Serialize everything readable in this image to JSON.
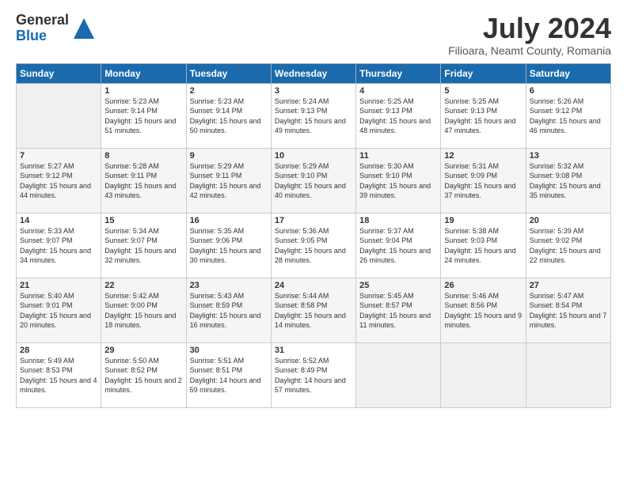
{
  "logo": {
    "general": "General",
    "blue": "Blue"
  },
  "title": "July 2024",
  "subtitle": "Filioara, Neamt County, Romania",
  "headers": [
    "Sunday",
    "Monday",
    "Tuesday",
    "Wednesday",
    "Thursday",
    "Friday",
    "Saturday"
  ],
  "weeks": [
    [
      {
        "day": "",
        "empty": true
      },
      {
        "day": "1",
        "sunrise": "Sunrise: 5:23 AM",
        "sunset": "Sunset: 9:14 PM",
        "daylight": "Daylight: 15 hours and 51 minutes."
      },
      {
        "day": "2",
        "sunrise": "Sunrise: 5:23 AM",
        "sunset": "Sunset: 9:14 PM",
        "daylight": "Daylight: 15 hours and 50 minutes."
      },
      {
        "day": "3",
        "sunrise": "Sunrise: 5:24 AM",
        "sunset": "Sunset: 9:13 PM",
        "daylight": "Daylight: 15 hours and 49 minutes."
      },
      {
        "day": "4",
        "sunrise": "Sunrise: 5:25 AM",
        "sunset": "Sunset: 9:13 PM",
        "daylight": "Daylight: 15 hours and 48 minutes."
      },
      {
        "day": "5",
        "sunrise": "Sunrise: 5:25 AM",
        "sunset": "Sunset: 9:13 PM",
        "daylight": "Daylight: 15 hours and 47 minutes."
      },
      {
        "day": "6",
        "sunrise": "Sunrise: 5:26 AM",
        "sunset": "Sunset: 9:12 PM",
        "daylight": "Daylight: 15 hours and 46 minutes."
      }
    ],
    [
      {
        "day": "7",
        "sunrise": "Sunrise: 5:27 AM",
        "sunset": "Sunset: 9:12 PM",
        "daylight": "Daylight: 15 hours and 44 minutes."
      },
      {
        "day": "8",
        "sunrise": "Sunrise: 5:28 AM",
        "sunset": "Sunset: 9:11 PM",
        "daylight": "Daylight: 15 hours and 43 minutes."
      },
      {
        "day": "9",
        "sunrise": "Sunrise: 5:29 AM",
        "sunset": "Sunset: 9:11 PM",
        "daylight": "Daylight: 15 hours and 42 minutes."
      },
      {
        "day": "10",
        "sunrise": "Sunrise: 5:29 AM",
        "sunset": "Sunset: 9:10 PM",
        "daylight": "Daylight: 15 hours and 40 minutes."
      },
      {
        "day": "11",
        "sunrise": "Sunrise: 5:30 AM",
        "sunset": "Sunset: 9:10 PM",
        "daylight": "Daylight: 15 hours and 39 minutes."
      },
      {
        "day": "12",
        "sunrise": "Sunrise: 5:31 AM",
        "sunset": "Sunset: 9:09 PM",
        "daylight": "Daylight: 15 hours and 37 minutes."
      },
      {
        "day": "13",
        "sunrise": "Sunrise: 5:32 AM",
        "sunset": "Sunset: 9:08 PM",
        "daylight": "Daylight: 15 hours and 35 minutes."
      }
    ],
    [
      {
        "day": "14",
        "sunrise": "Sunrise: 5:33 AM",
        "sunset": "Sunset: 9:07 PM",
        "daylight": "Daylight: 15 hours and 34 minutes."
      },
      {
        "day": "15",
        "sunrise": "Sunrise: 5:34 AM",
        "sunset": "Sunset: 9:07 PM",
        "daylight": "Daylight: 15 hours and 32 minutes."
      },
      {
        "day": "16",
        "sunrise": "Sunrise: 5:35 AM",
        "sunset": "Sunset: 9:06 PM",
        "daylight": "Daylight: 15 hours and 30 minutes."
      },
      {
        "day": "17",
        "sunrise": "Sunrise: 5:36 AM",
        "sunset": "Sunset: 9:05 PM",
        "daylight": "Daylight: 15 hours and 28 minutes."
      },
      {
        "day": "18",
        "sunrise": "Sunrise: 5:37 AM",
        "sunset": "Sunset: 9:04 PM",
        "daylight": "Daylight: 15 hours and 26 minutes."
      },
      {
        "day": "19",
        "sunrise": "Sunrise: 5:38 AM",
        "sunset": "Sunset: 9:03 PM",
        "daylight": "Daylight: 15 hours and 24 minutes."
      },
      {
        "day": "20",
        "sunrise": "Sunrise: 5:39 AM",
        "sunset": "Sunset: 9:02 PM",
        "daylight": "Daylight: 15 hours and 22 minutes."
      }
    ],
    [
      {
        "day": "21",
        "sunrise": "Sunrise: 5:40 AM",
        "sunset": "Sunset: 9:01 PM",
        "daylight": "Daylight: 15 hours and 20 minutes."
      },
      {
        "day": "22",
        "sunrise": "Sunrise: 5:42 AM",
        "sunset": "Sunset: 9:00 PM",
        "daylight": "Daylight: 15 hours and 18 minutes."
      },
      {
        "day": "23",
        "sunrise": "Sunrise: 5:43 AM",
        "sunset": "Sunset: 8:59 PM",
        "daylight": "Daylight: 15 hours and 16 minutes."
      },
      {
        "day": "24",
        "sunrise": "Sunrise: 5:44 AM",
        "sunset": "Sunset: 8:58 PM",
        "daylight": "Daylight: 15 hours and 14 minutes."
      },
      {
        "day": "25",
        "sunrise": "Sunrise: 5:45 AM",
        "sunset": "Sunset: 8:57 PM",
        "daylight": "Daylight: 15 hours and 11 minutes."
      },
      {
        "day": "26",
        "sunrise": "Sunrise: 5:46 AM",
        "sunset": "Sunset: 8:56 PM",
        "daylight": "Daylight: 15 hours and 9 minutes."
      },
      {
        "day": "27",
        "sunrise": "Sunrise: 5:47 AM",
        "sunset": "Sunset: 8:54 PM",
        "daylight": "Daylight: 15 hours and 7 minutes."
      }
    ],
    [
      {
        "day": "28",
        "sunrise": "Sunrise: 5:49 AM",
        "sunset": "Sunset: 8:53 PM",
        "daylight": "Daylight: 15 hours and 4 minutes."
      },
      {
        "day": "29",
        "sunrise": "Sunrise: 5:50 AM",
        "sunset": "Sunset: 8:52 PM",
        "daylight": "Daylight: 15 hours and 2 minutes."
      },
      {
        "day": "30",
        "sunrise": "Sunrise: 5:51 AM",
        "sunset": "Sunset: 8:51 PM",
        "daylight": "Daylight: 14 hours and 59 minutes."
      },
      {
        "day": "31",
        "sunrise": "Sunrise: 5:52 AM",
        "sunset": "Sunset: 8:49 PM",
        "daylight": "Daylight: 14 hours and 57 minutes."
      },
      {
        "day": "",
        "empty": true
      },
      {
        "day": "",
        "empty": true
      },
      {
        "day": "",
        "empty": true
      }
    ]
  ]
}
